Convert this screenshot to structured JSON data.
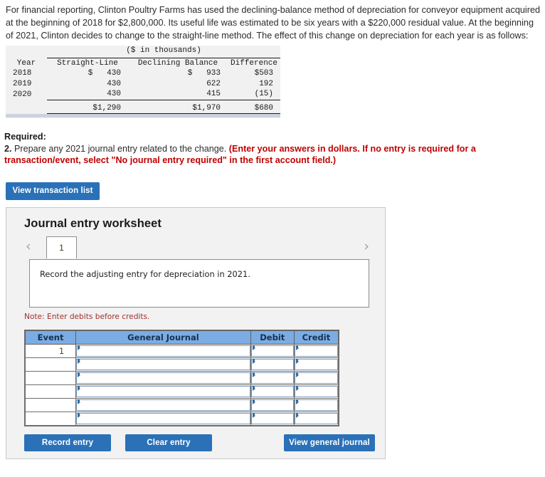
{
  "problem": {
    "paragraph": "For financial reporting, Clinton Poultry Farms has used the declining-balance method of depreciation for conveyor equipment acquired at the beginning of 2018 for $2,800,000. Its useful life was estimated to be six years with a $220,000 residual value. At the beginning of 2021, Clinton decides to change to the straight-line method. The effect of this change on depreciation for each year is as follows:"
  },
  "depreciation_table": {
    "units_header": "($ in thousands)",
    "columns": [
      "Year",
      "Straight-Line",
      "Declining Balance",
      "Difference"
    ],
    "rows": [
      {
        "year": "2018",
        "straight_line": "$   430",
        "declining_balance": "$   933",
        "difference": "$503"
      },
      {
        "year": "2019",
        "straight_line": "430",
        "declining_balance": "622",
        "difference": "192"
      },
      {
        "year": "2020",
        "straight_line": "430",
        "declining_balance": "415",
        "difference": "(15)"
      }
    ],
    "totals": {
      "year": "",
      "straight_line": "$1,290",
      "declining_balance": "$1,970",
      "difference": "$680"
    }
  },
  "required": {
    "label": "Required:",
    "number": "2.",
    "text": " Prepare any 2021 journal entry related to the change. ",
    "red_text": "(Enter your answers in dollars. If no entry is required for a transaction/event, select \"No journal entry required\" in the first account field.)"
  },
  "buttons": {
    "view_transaction_list": "View transaction list",
    "record_entry": "Record entry",
    "clear_entry": "Clear entry",
    "view_general_journal": "View general journal"
  },
  "worksheet": {
    "title": "Journal entry worksheet",
    "pager": {
      "prev_icon": "‹",
      "next_icon": "›",
      "current_tab": "1"
    },
    "description": "Record the adjusting entry for depreciation in 2021.",
    "note": "Note: Enter debits before credits.",
    "journal_table": {
      "headers": [
        "Event",
        "General Journal",
        "Debit",
        "Credit"
      ],
      "rows": [
        {
          "event": "1",
          "general_journal": "",
          "debit": "",
          "credit": ""
        },
        {
          "event": "",
          "general_journal": "",
          "debit": "",
          "credit": ""
        },
        {
          "event": "",
          "general_journal": "",
          "debit": "",
          "credit": ""
        },
        {
          "event": "",
          "general_journal": "",
          "debit": "",
          "credit": ""
        },
        {
          "event": "",
          "general_journal": "",
          "debit": "",
          "credit": ""
        },
        {
          "event": "",
          "general_journal": "",
          "debit": "",
          "credit": ""
        }
      ]
    }
  },
  "colors": {
    "button_blue": "#2a71b8",
    "table_header_blue": "#7cace4",
    "panel_gray": "#f2f2f2",
    "red_text": "#c00000",
    "rule_bar": "#ccd2e0"
  }
}
